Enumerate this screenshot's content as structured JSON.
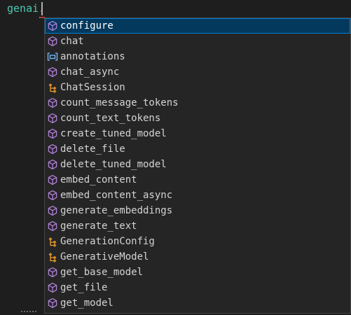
{
  "editor": {
    "code_prefix": "genai",
    "code_dot": "."
  },
  "suggest": {
    "selected_index": 0,
    "items": [
      {
        "label": "configure",
        "kind": "method",
        "icon": "method-icon"
      },
      {
        "label": "chat",
        "kind": "method",
        "icon": "method-icon"
      },
      {
        "label": "annotations",
        "kind": "variable",
        "icon": "variable-icon"
      },
      {
        "label": "chat_async",
        "kind": "method",
        "icon": "method-icon"
      },
      {
        "label": "ChatSession",
        "kind": "class",
        "icon": "class-icon"
      },
      {
        "label": "count_message_tokens",
        "kind": "method",
        "icon": "method-icon"
      },
      {
        "label": "count_text_tokens",
        "kind": "method",
        "icon": "method-icon"
      },
      {
        "label": "create_tuned_model",
        "kind": "method",
        "icon": "method-icon"
      },
      {
        "label": "delete_file",
        "kind": "method",
        "icon": "method-icon"
      },
      {
        "label": "delete_tuned_model",
        "kind": "method",
        "icon": "method-icon"
      },
      {
        "label": "embed_content",
        "kind": "method",
        "icon": "method-icon"
      },
      {
        "label": "embed_content_async",
        "kind": "method",
        "icon": "method-icon"
      },
      {
        "label": "generate_embeddings",
        "kind": "method",
        "icon": "method-icon"
      },
      {
        "label": "generate_text",
        "kind": "method",
        "icon": "method-icon"
      },
      {
        "label": "GenerationConfig",
        "kind": "class",
        "icon": "class-icon"
      },
      {
        "label": "GenerativeModel",
        "kind": "class",
        "icon": "class-icon"
      },
      {
        "label": "get_base_model",
        "kind": "method",
        "icon": "method-icon"
      },
      {
        "label": "get_file",
        "kind": "method",
        "icon": "method-icon"
      },
      {
        "label": "get_model",
        "kind": "method",
        "icon": "method-icon"
      }
    ]
  },
  "colors": {
    "background": "#1e1e1e",
    "widget_background": "#252526",
    "selected_background": "#04395e",
    "selected_border": "#007fd4",
    "method_icon": "#b180d7",
    "class_icon": "#ee9d28",
    "variable_icon": "#75beff",
    "text": "#d4d4d4",
    "type_text": "#4ec9b0"
  }
}
